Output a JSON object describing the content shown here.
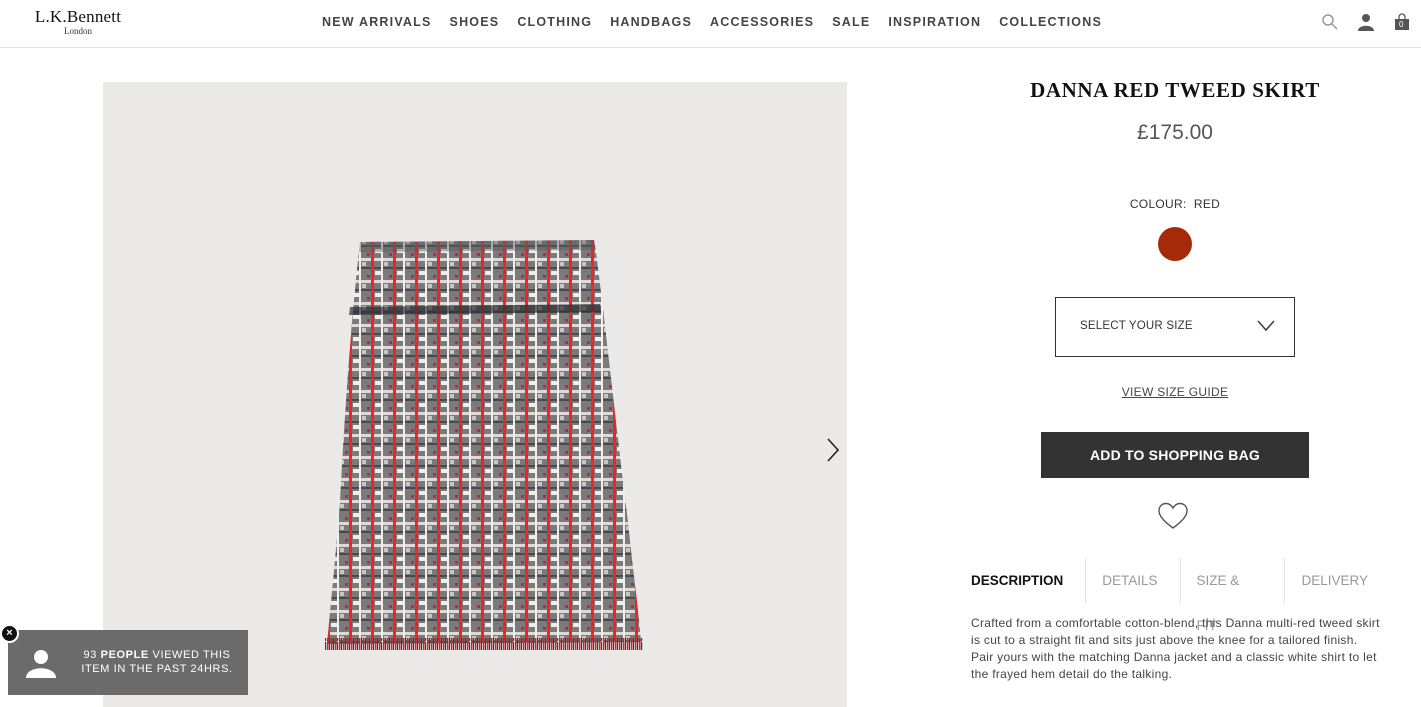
{
  "header": {
    "brand": "L.K.Bennett",
    "city": "London",
    "nav": [
      "NEW ARRIVALS",
      "SHOES",
      "CLOTHING",
      "HANDBAGS",
      "ACCESSORIES",
      "SALE",
      "INSPIRATION",
      "COLLECTIONS"
    ],
    "icons": [
      "search-icon",
      "account-icon",
      "shopping-bag-icon"
    ],
    "bag_count": "0"
  },
  "product": {
    "title": "DANNA RED TWEED SKIRT",
    "price": "£175.00",
    "colour_label": "COLOUR:",
    "colour_value": "RED",
    "swatch_color": "#a52a09",
    "size_placeholder": "SELECT YOUR SIZE",
    "size_guide": "VIEW SIZE GUIDE",
    "add_to_bag": "ADD TO SHOPPING BAG",
    "tabs": [
      "DESCRIPTION",
      "DETAILS",
      "SIZE & FIT",
      "DELIVERY"
    ],
    "description": "Crafted from a comfortable cotton-blend, this Danna multi-red tweed skirt is cut to a straight fit and sits just above the knee for a tailored finish. Pair yours with the matching Danna jacket and a classic white shirt to let the frayed hem detail do the talking."
  },
  "popup": {
    "count": "93",
    "people": "PEOPLE",
    "rest": "VIEWED THIS ITEM IN THE PAST 24HRS."
  }
}
